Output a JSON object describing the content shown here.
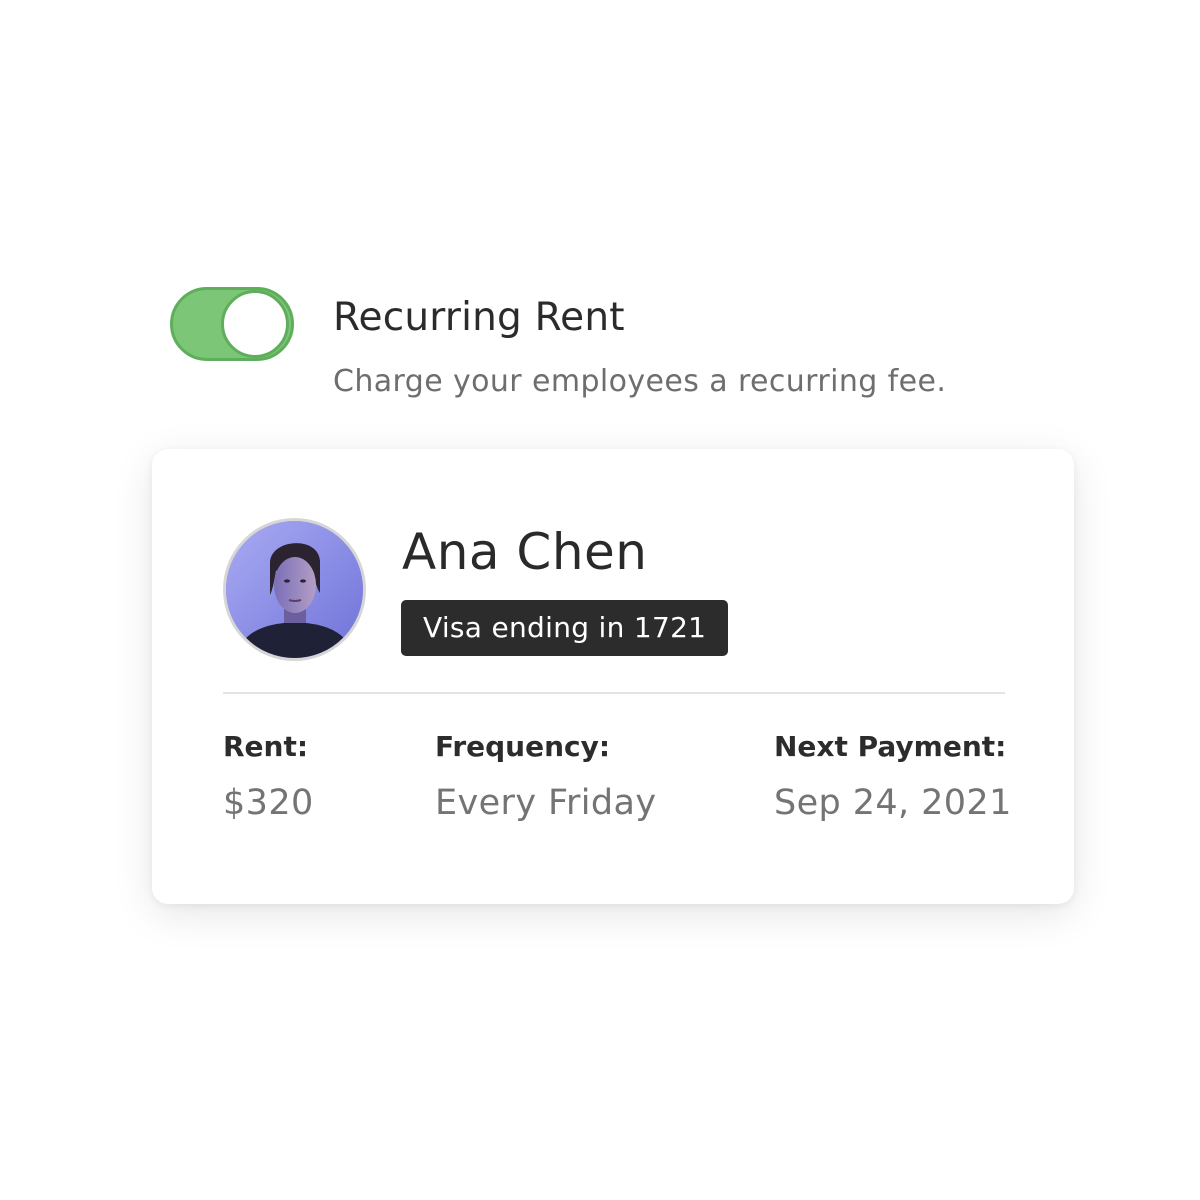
{
  "setting": {
    "title": "Recurring Rent",
    "description": "Charge your employees a recurring fee.",
    "toggle_on": true,
    "toggle_color": "#7bc677"
  },
  "tenant": {
    "name": "Ana Chen",
    "payment_badge": "Visa ending in 1721",
    "avatar_icon": "user-photo"
  },
  "details": {
    "rent_label": "Rent:",
    "rent_value": "$320",
    "frequency_label": "Frequency:",
    "frequency_value": "Every Friday",
    "next_payment_label": "Next Payment:",
    "next_payment_value": "Sep 24, 2021"
  }
}
